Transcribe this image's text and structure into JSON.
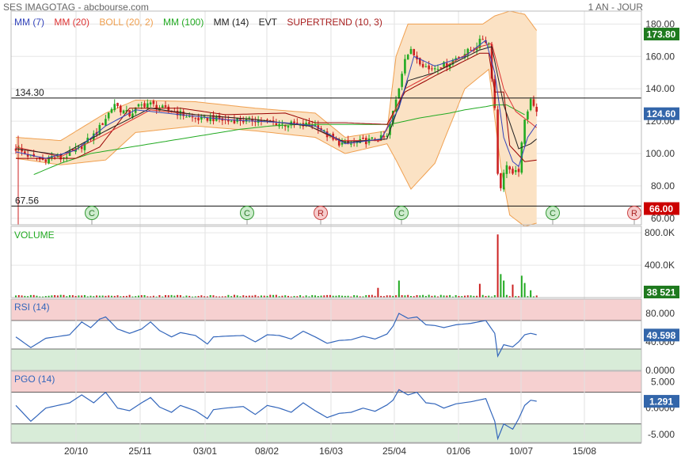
{
  "header": {
    "title": "SES IMAGOTAG - abcbourse.com",
    "period": "1 AN - JOUR"
  },
  "legend": [
    {
      "label": "MM (7)",
      "color": "#3344bb"
    },
    {
      "label": "MM (20)",
      "color": "#dd3333"
    },
    {
      "label": "BOLL (20, 2)",
      "color": "#f0a050"
    },
    {
      "label": "MM (100)",
      "color": "#22aa22"
    },
    {
      "label": "MM (14)",
      "color": "#222222"
    },
    {
      "label": "EVT",
      "color": "#222222"
    },
    {
      "label": "SUPERTREND (10, 3)",
      "color": "#aa2222"
    }
  ],
  "colors": {
    "up": "#22aa22",
    "down": "#cc2222",
    "boll_fill": "#fbe2c4",
    "boll_line": "#f0a050",
    "mm7": "#3344bb",
    "mm20": "#dd3333",
    "mm100": "#22aa22",
    "mm14": "#222222",
    "supertrend": "#990000",
    "osc_line": "#3366bb",
    "zone_high": "#f6d0d0",
    "zone_low": "#d8ecd8",
    "badge_price": "#1f7a1f",
    "badge_last": "#3366aa",
    "badge_low": "#cc0000"
  },
  "chart_data": [
    {
      "type": "candlestick",
      "panel": "price",
      "title": "SES IMAGOTAG",
      "y_ticks": [
        "180.00",
        "160.00",
        "140.00",
        "120.00",
        "100.00",
        "80.00",
        "60.00"
      ],
      "ylim": [
        56,
        188
      ],
      "x_ticks": [
        "20/10",
        "25/11",
        "03/01",
        "08/02",
        "16/03",
        "25/04",
        "01/06",
        "10/07",
        "15/08"
      ],
      "hlines": [
        {
          "label": "134.30",
          "value": 134.3
        },
        {
          "label": "67.56",
          "value": 67.56
        }
      ],
      "price_badges": [
        {
          "label": "173.80",
          "value": 173.8,
          "kind": "high"
        },
        {
          "label": "124.60",
          "value": 124.6,
          "kind": "last"
        },
        {
          "label": "66.00",
          "value": 66.0,
          "kind": "low"
        }
      ],
      "events": [
        {
          "label": "C",
          "type": "C",
          "date": "17/10"
        },
        {
          "label": "C",
          "type": "C",
          "date": "12/01"
        },
        {
          "label": "R",
          "type": "R",
          "date": "15/03"
        },
        {
          "label": "C",
          "type": "C",
          "date": "26/04"
        },
        {
          "label": "C",
          "type": "C",
          "date": "25/07"
        },
        {
          "label": "R",
          "type": "R",
          "date": "25/08"
        }
      ],
      "close_path": [
        [
          0,
          103
        ],
        [
          3,
          100
        ],
        [
          6,
          97
        ],
        [
          9,
          96
        ],
        [
          12,
          98
        ],
        [
          15,
          97
        ],
        [
          18,
          100
        ],
        [
          21,
          103
        ],
        [
          24,
          108
        ],
        [
          27,
          113
        ],
        [
          30,
          122
        ],
        [
          33,
          131
        ],
        [
          35,
          127
        ],
        [
          38,
          124
        ],
        [
          41,
          129
        ],
        [
          44,
          131
        ],
        [
          47,
          129
        ],
        [
          50,
          127
        ],
        [
          53,
          126
        ],
        [
          56,
          124
        ],
        [
          59,
          122
        ],
        [
          62,
          121
        ],
        [
          65,
          122
        ],
        [
          68,
          121
        ],
        [
          71,
          120
        ],
        [
          74,
          121
        ],
        [
          77,
          120
        ],
        [
          80,
          121
        ],
        [
          83,
          120
        ],
        [
          86,
          119
        ],
        [
          89,
          118
        ],
        [
          92,
          118
        ],
        [
          95,
          117
        ],
        [
          98,
          118
        ],
        [
          101,
          117
        ],
        [
          103,
          113
        ],
        [
          106,
          108
        ],
        [
          109,
          106
        ],
        [
          112,
          106
        ],
        [
          115,
          107
        ],
        [
          118,
          108
        ],
        [
          121,
          109
        ],
        [
          124,
          110
        ],
        [
          127,
          133
        ],
        [
          128,
          141
        ],
        [
          130,
          160
        ],
        [
          132,
          163
        ],
        [
          135,
          157
        ],
        [
          138,
          152
        ],
        [
          141,
          154
        ],
        [
          144,
          155
        ],
        [
          147,
          159
        ],
        [
          150,
          162
        ],
        [
          153,
          165
        ],
        [
          156,
          171
        ],
        [
          158,
          168
        ],
        [
          160,
          128
        ],
        [
          161,
          88
        ],
        [
          162,
          80
        ],
        [
          164,
          94
        ],
        [
          166,
          86
        ],
        [
          168,
          90
        ],
        [
          170,
          120
        ],
        [
          172,
          135
        ],
        [
          174,
          124.6
        ]
      ],
      "mm7_path": [
        [
          0,
          101
        ],
        [
          10,
          97
        ],
        [
          20,
          102
        ],
        [
          30,
          117
        ],
        [
          40,
          127
        ],
        [
          55,
          124
        ],
        [
          70,
          121
        ],
        [
          90,
          119
        ],
        [
          100,
          117
        ],
        [
          110,
          106
        ],
        [
          122,
          109
        ],
        [
          128,
          128
        ],
        [
          133,
          160
        ],
        [
          140,
          154
        ],
        [
          150,
          160
        ],
        [
          157,
          170
        ],
        [
          160,
          150
        ],
        [
          163,
          110
        ],
        [
          166,
          95
        ],
        [
          168,
          92
        ],
        [
          171,
          110
        ],
        [
          174,
          118
        ]
      ],
      "mm20_path": [
        [
          0,
          104
        ],
        [
          15,
          98
        ],
        [
          30,
          112
        ],
        [
          45,
          127
        ],
        [
          60,
          124
        ],
        [
          80,
          121
        ],
        [
          98,
          117
        ],
        [
          108,
          108
        ],
        [
          122,
          108
        ],
        [
          130,
          140
        ],
        [
          140,
          150
        ],
        [
          155,
          166
        ],
        [
          159,
          168
        ],
        [
          163,
          140
        ],
        [
          167,
          126
        ],
        [
          174,
          116
        ]
      ],
      "mm14_path": [
        [
          0,
          103
        ],
        [
          15,
          99
        ],
        [
          30,
          114
        ],
        [
          45,
          128
        ],
        [
          60,
          124
        ],
        [
          80,
          121
        ],
        [
          98,
          117
        ],
        [
          110,
          107
        ],
        [
          124,
          109
        ],
        [
          131,
          145
        ],
        [
          140,
          150
        ],
        [
          155,
          164
        ],
        [
          159,
          166
        ],
        [
          163,
          130
        ],
        [
          168,
          103
        ],
        [
          172,
          106
        ],
        [
          174,
          109
        ]
      ],
      "mm100_path": [
        [
          6,
          87
        ],
        [
          15,
          94
        ],
        [
          25,
          100
        ],
        [
          35,
          103
        ],
        [
          45,
          106
        ],
        [
          55,
          109
        ],
        [
          65,
          112
        ],
        [
          75,
          115
        ],
        [
          85,
          117
        ],
        [
          95,
          118
        ],
        [
          105,
          118
        ],
        [
          115,
          118
        ],
        [
          125,
          118
        ],
        [
          135,
          122
        ],
        [
          145,
          125
        ],
        [
          150,
          127
        ],
        [
          157,
          129
        ],
        [
          160,
          130
        ],
        [
          164,
          130
        ],
        [
          167,
          127
        ],
        [
          170,
          124
        ]
      ],
      "supertrend_path": [
        [
          0,
          97
        ],
        [
          20,
          97
        ],
        [
          28,
          104
        ],
        [
          38,
          128
        ],
        [
          55,
          128
        ],
        [
          70,
          124
        ],
        [
          90,
          125
        ],
        [
          100,
          119
        ],
        [
          110,
          119
        ],
        [
          124,
          118
        ],
        [
          130,
          138
        ],
        [
          140,
          148
        ],
        [
          155,
          162
        ],
        [
          158,
          162
        ],
        [
          160,
          138
        ],
        [
          163,
          138
        ],
        [
          165,
          105
        ],
        [
          170,
          95
        ],
        [
          174,
          96
        ]
      ],
      "boll_upper": [
        [
          0,
          110
        ],
        [
          15,
          108
        ],
        [
          30,
          125
        ],
        [
          40,
          133
        ],
        [
          60,
          132
        ],
        [
          80,
          128
        ],
        [
          100,
          125
        ],
        [
          110,
          110
        ],
        [
          124,
          114
        ],
        [
          127,
          160
        ],
        [
          131,
          180
        ],
        [
          140,
          180
        ],
        [
          150,
          180
        ],
        [
          156,
          180
        ],
        [
          160,
          185
        ],
        [
          165,
          188
        ],
        [
          170,
          186
        ],
        [
          174,
          176
        ]
      ],
      "boll_lower": [
        [
          0,
          97
        ],
        [
          15,
          93
        ],
        [
          30,
          96
        ],
        [
          40,
          113
        ],
        [
          60,
          117
        ],
        [
          80,
          114
        ],
        [
          100,
          110
        ],
        [
          110,
          100
        ],
        [
          124,
          106
        ],
        [
          127,
          96
        ],
        [
          132,
          78
        ],
        [
          140,
          94
        ],
        [
          150,
          140
        ],
        [
          158,
          152
        ],
        [
          162,
          92
        ],
        [
          165,
          62
        ],
        [
          170,
          55
        ],
        [
          174,
          57
        ]
      ]
    },
    {
      "type": "bar",
      "panel": "volume",
      "title": "VOLUME",
      "y_ticks": [
        "800.0K",
        "400.0K"
      ],
      "ylim": [
        0,
        880000
      ],
      "last_label": "38 521",
      "spikes": [
        {
          "x": 121,
          "value": 120000,
          "up": false
        },
        {
          "x": 128,
          "value": 210000,
          "up": true
        },
        {
          "x": 155,
          "value": 170000,
          "up": false
        },
        {
          "x": 161,
          "value": 780000,
          "up": false
        },
        {
          "x": 162,
          "value": 290000,
          "up": true
        },
        {
          "x": 163,
          "value": 210000,
          "up": true
        },
        {
          "x": 166,
          "value": 160000,
          "up": false
        },
        {
          "x": 169,
          "value": 270000,
          "up": true
        },
        {
          "x": 170,
          "value": 180000,
          "up": true
        },
        {
          "x": 172,
          "value": 90000,
          "up": true
        }
      ]
    },
    {
      "type": "line",
      "panel": "rsi",
      "title": "RSI (14)",
      "y_ticks": [
        "80.000",
        "40.000",
        "0.0000"
      ],
      "ylim": [
        0,
        100
      ],
      "zones": [
        70,
        30
      ],
      "last_label": "49.598",
      "path": [
        [
          0,
          47
        ],
        [
          5,
          32
        ],
        [
          10,
          45
        ],
        [
          18,
          50
        ],
        [
          22,
          68
        ],
        [
          25,
          60
        ],
        [
          28,
          72
        ],
        [
          30,
          75
        ],
        [
          34,
          58
        ],
        [
          38,
          52
        ],
        [
          42,
          58
        ],
        [
          45,
          68
        ],
        [
          48,
          56
        ],
        [
          52,
          47
        ],
        [
          55,
          53
        ],
        [
          60,
          49
        ],
        [
          64,
          37
        ],
        [
          66,
          47
        ],
        [
          70,
          48
        ],
        [
          76,
          49
        ],
        [
          80,
          40
        ],
        [
          84,
          50
        ],
        [
          88,
          49
        ],
        [
          92,
          44
        ],
        [
          96,
          55
        ],
        [
          100,
          47
        ],
        [
          104,
          38
        ],
        [
          108,
          42
        ],
        [
          112,
          43
        ],
        [
          116,
          48
        ],
        [
          120,
          44
        ],
        [
          124,
          51
        ],
        [
          126,
          62
        ],
        [
          128,
          80
        ],
        [
          131,
          73
        ],
        [
          134,
          75
        ],
        [
          137,
          64
        ],
        [
          140,
          63
        ],
        [
          143,
          60
        ],
        [
          147,
          64
        ],
        [
          152,
          66
        ],
        [
          157,
          70
        ],
        [
          160,
          52
        ],
        [
          161,
          20
        ],
        [
          163,
          36
        ],
        [
          166,
          33
        ],
        [
          168,
          40
        ],
        [
          170,
          50
        ],
        [
          172,
          52
        ],
        [
          174,
          50
        ]
      ]
    },
    {
      "type": "line",
      "panel": "pgo",
      "title": "PGO (14)",
      "y_ticks": [
        "5.000",
        "0.0000",
        "-5.000"
      ],
      "ylim": [
        -6.5,
        7.0
      ],
      "zones": [
        3.0,
        -3.0
      ],
      "last_label": "1.291",
      "path": [
        [
          0,
          0.5
        ],
        [
          5,
          -2.5
        ],
        [
          10,
          0
        ],
        [
          18,
          1
        ],
        [
          22,
          2.5
        ],
        [
          26,
          1
        ],
        [
          30,
          3
        ],
        [
          34,
          0
        ],
        [
          38,
          -0.5
        ],
        [
          42,
          1
        ],
        [
          45,
          2
        ],
        [
          48,
          0.2
        ],
        [
          52,
          -0.8
        ],
        [
          55,
          0.5
        ],
        [
          60,
          -0.5
        ],
        [
          64,
          -2
        ],
        [
          66,
          -0.3
        ],
        [
          70,
          0
        ],
        [
          76,
          0.3
        ],
        [
          80,
          -1.2
        ],
        [
          84,
          0.5
        ],
        [
          88,
          0
        ],
        [
          92,
          -0.8
        ],
        [
          96,
          1
        ],
        [
          100,
          -0.5
        ],
        [
          104,
          -1.8
        ],
        [
          108,
          -1
        ],
        [
          112,
          -0.8
        ],
        [
          116,
          0
        ],
        [
          120,
          -0.6
        ],
        [
          124,
          0.6
        ],
        [
          126,
          1.5
        ],
        [
          128,
          3.5
        ],
        [
          131,
          2.5
        ],
        [
          134,
          3.0
        ],
        [
          137,
          1.0
        ],
        [
          140,
          0.8
        ],
        [
          143,
          0
        ],
        [
          147,
          0.8
        ],
        [
          152,
          1.2
        ],
        [
          157,
          1.8
        ],
        [
          160,
          -2.5
        ],
        [
          161,
          -5.8
        ],
        [
          163,
          -3
        ],
        [
          166,
          -4
        ],
        [
          168,
          -2
        ],
        [
          170,
          0.5
        ],
        [
          172,
          1.5
        ],
        [
          174,
          1.3
        ]
      ]
    }
  ]
}
